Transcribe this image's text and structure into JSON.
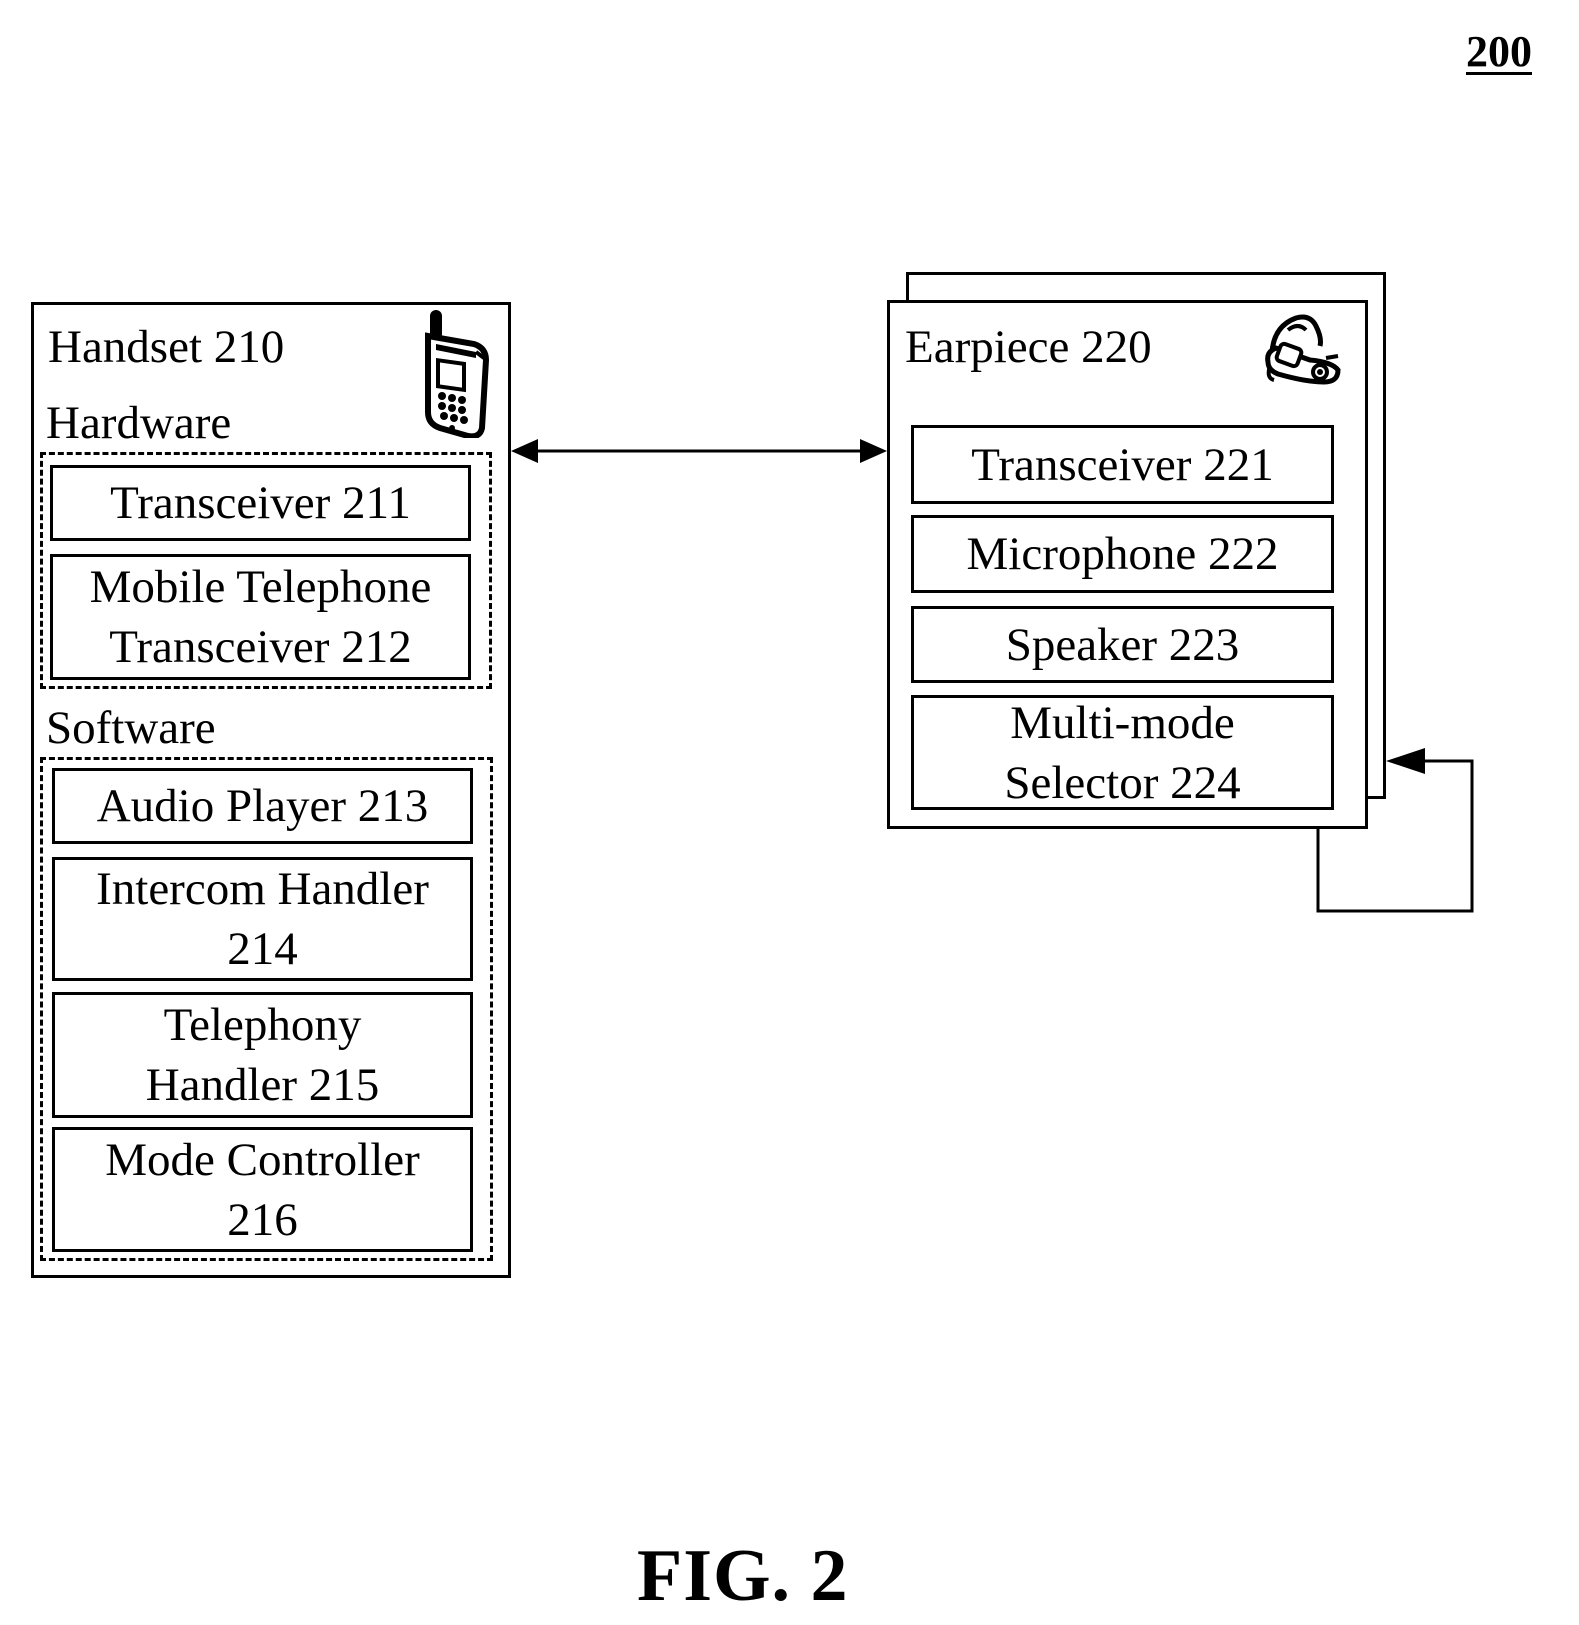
{
  "figure": {
    "number": "200",
    "label": "FIG. 2"
  },
  "handset": {
    "title": "Handset 210",
    "icon": "mobile-phone-icon",
    "hardware": {
      "label": "Hardware",
      "components": [
        {
          "id": "211",
          "lines": [
            "Transceiver 211"
          ]
        },
        {
          "id": "212",
          "lines": [
            "Mobile Telephone",
            "Transceiver 212"
          ]
        }
      ]
    },
    "software": {
      "label": "Software",
      "components": [
        {
          "id": "213",
          "lines": [
            "Audio Player 213"
          ]
        },
        {
          "id": "214",
          "lines": [
            "Intercom Handler",
            "214"
          ]
        },
        {
          "id": "215",
          "lines": [
            "Telephony",
            "Handler 215"
          ]
        },
        {
          "id": "216",
          "lines": [
            "Mode Controller",
            "216"
          ]
        }
      ]
    }
  },
  "earpiece": {
    "title": "Earpiece 220",
    "icon": "bluetooth-earpiece-icon",
    "stacked": true,
    "components": [
      {
        "id": "221",
        "lines": [
          "Transceiver 221"
        ]
      },
      {
        "id": "222",
        "lines": [
          "Microphone 222"
        ]
      },
      {
        "id": "223",
        "lines": [
          "Speaker 223"
        ]
      },
      {
        "id": "224",
        "lines": [
          "Multi-mode",
          "Selector 224"
        ]
      }
    ]
  },
  "connections": [
    {
      "from": "Handset 210",
      "to": "Earpiece 220",
      "type": "bidirectional"
    },
    {
      "from": "Earpiece 220",
      "to": "Earpiece 220",
      "type": "feedback-loop"
    }
  ]
}
